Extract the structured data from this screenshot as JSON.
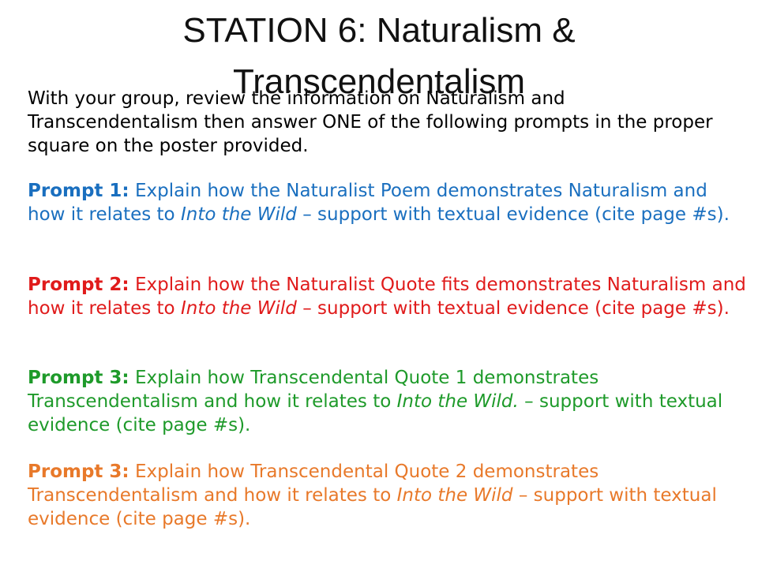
{
  "title": {
    "line1": "STATION 6: Naturalism &",
    "line2": "Transcendentalism"
  },
  "intro": "With your group, review the information on Naturalism and Transcendentalism then answer ONE of the following prompts in the proper square on the poster provided.",
  "colors": {
    "prompt1": "#1a6fbf",
    "prompt2": "#e01b1b",
    "prompt3a": "#1e9a2a",
    "prompt3b": "#e8792a"
  },
  "prompts": [
    {
      "label": "Prompt 1:",
      "text1": " Explain how the Naturalist Poem demonstrates Naturalism and how it relates to ",
      "em": "Into the Wild",
      "text2": " – support with textual evidence (cite page #s)."
    },
    {
      "label": "Prompt 2:",
      "text1": " Explain how the Naturalist Quote fits demonstrates Naturalism and how it relates to ",
      "em": "Into the Wild",
      "text2": " – support with textual evidence (cite page #s)."
    },
    {
      "label": "Prompt 3:",
      "text1": " Explain how Transcendental Quote 1 demonstrates Transcendentalism and how it relates to ",
      "em": "Into the Wild.",
      "text2": " – support with textual evidence (cite page #s)."
    },
    {
      "label": "Prompt 3:",
      "text1": " Explain how Transcendental Quote 2 demonstrates Transcendentalism and how it relates to ",
      "em": "Into the Wild",
      "text2": " – support with textual evidence (cite page #s)."
    }
  ]
}
